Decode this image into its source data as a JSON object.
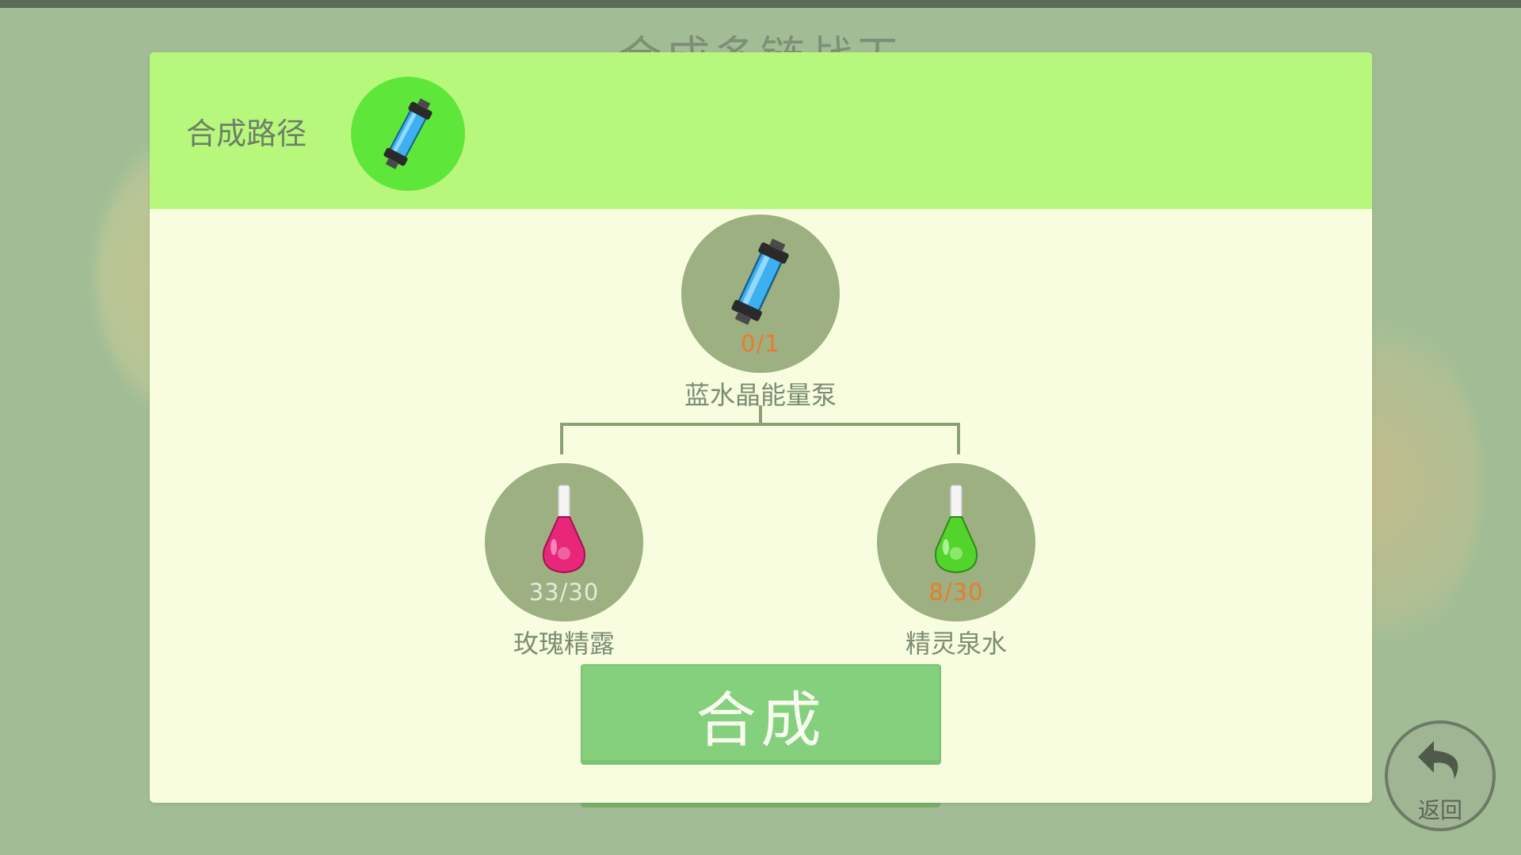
{
  "background": {
    "title": "合成多链战天"
  },
  "dialog": {
    "header_label": "合成路径",
    "path": [
      {
        "icon": "blue-crystal-pump-icon"
      }
    ]
  },
  "recipe": {
    "target": {
      "name": "蓝水晶能量泵",
      "count": "0/1",
      "icon": "blue-crystal-pump-icon",
      "count_color": "#ee7a2a"
    },
    "materials": [
      {
        "name": "玫瑰精露",
        "count": "33/30",
        "icon": "pink-potion-flask-icon",
        "count_color": "#e4ecd8"
      },
      {
        "name": "精灵泉水",
        "count": "8/30",
        "icon": "green-potion-flask-icon",
        "count_color": "#ee7a2a"
      }
    ]
  },
  "actions": {
    "craft_label": "合成",
    "back_label": "返回"
  },
  "colors": {
    "header_bg": "#b7f77c",
    "panel_bg": "#f8fde0",
    "item_circle": "#9cb081",
    "craft_button": "#85d07c",
    "path_node": "#5ee63a"
  }
}
